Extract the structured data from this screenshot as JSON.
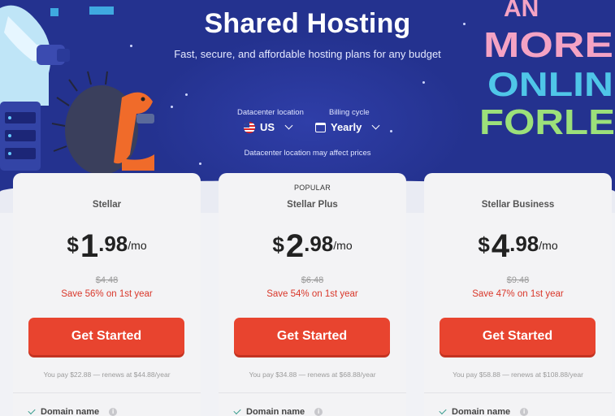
{
  "hero": {
    "title": "Shared Hosting",
    "subtitle": "Fast, secure, and affordable hosting plans for any budget",
    "datacenter_label": "Datacenter location",
    "datacenter_value": "US",
    "billing_label": "Billing cycle",
    "billing_value": "Yearly",
    "note": "Datacenter location may affect prices",
    "deco_text": [
      "MORE",
      "ONLIN",
      "FORLE"
    ]
  },
  "plans": [
    {
      "popular": "",
      "name": "Stellar",
      "currency": "$",
      "dollars": "1",
      "cents": ".98",
      "period": "/mo",
      "old_price": "$4.48",
      "save": "Save 56% on 1st year",
      "button": "Get Started",
      "pay": "You pay $22.88 — renews at $44.88/year",
      "feature": "Domain name"
    },
    {
      "popular": "POPULAR",
      "name": "Stellar Plus",
      "currency": "$",
      "dollars": "2",
      "cents": ".98",
      "period": "/mo",
      "old_price": "$6.48",
      "save": "Save 54% on 1st year",
      "button": "Get Started",
      "pay": "You pay $34.88 — renews at $68.88/year",
      "feature": "Domain name"
    },
    {
      "popular": "",
      "name": "Stellar Business",
      "currency": "$",
      "dollars": "4",
      "cents": ".98",
      "period": "/mo",
      "old_price": "$9.48",
      "save": "Save 47% on 1st year",
      "button": "Get Started",
      "pay": "You pay $58.88 — renews at $108.88/year",
      "feature": "Domain name"
    }
  ],
  "icons": {
    "flag": "us-flag-icon",
    "calendar": "calendar-icon",
    "chevron": "chevron-down-icon",
    "check": "check-icon",
    "info": "info-icon"
  },
  "colors": {
    "hero_bg": "#24328f",
    "accent": "#e8442f",
    "save_text": "#d9372a",
    "check": "#3a9e8f"
  }
}
